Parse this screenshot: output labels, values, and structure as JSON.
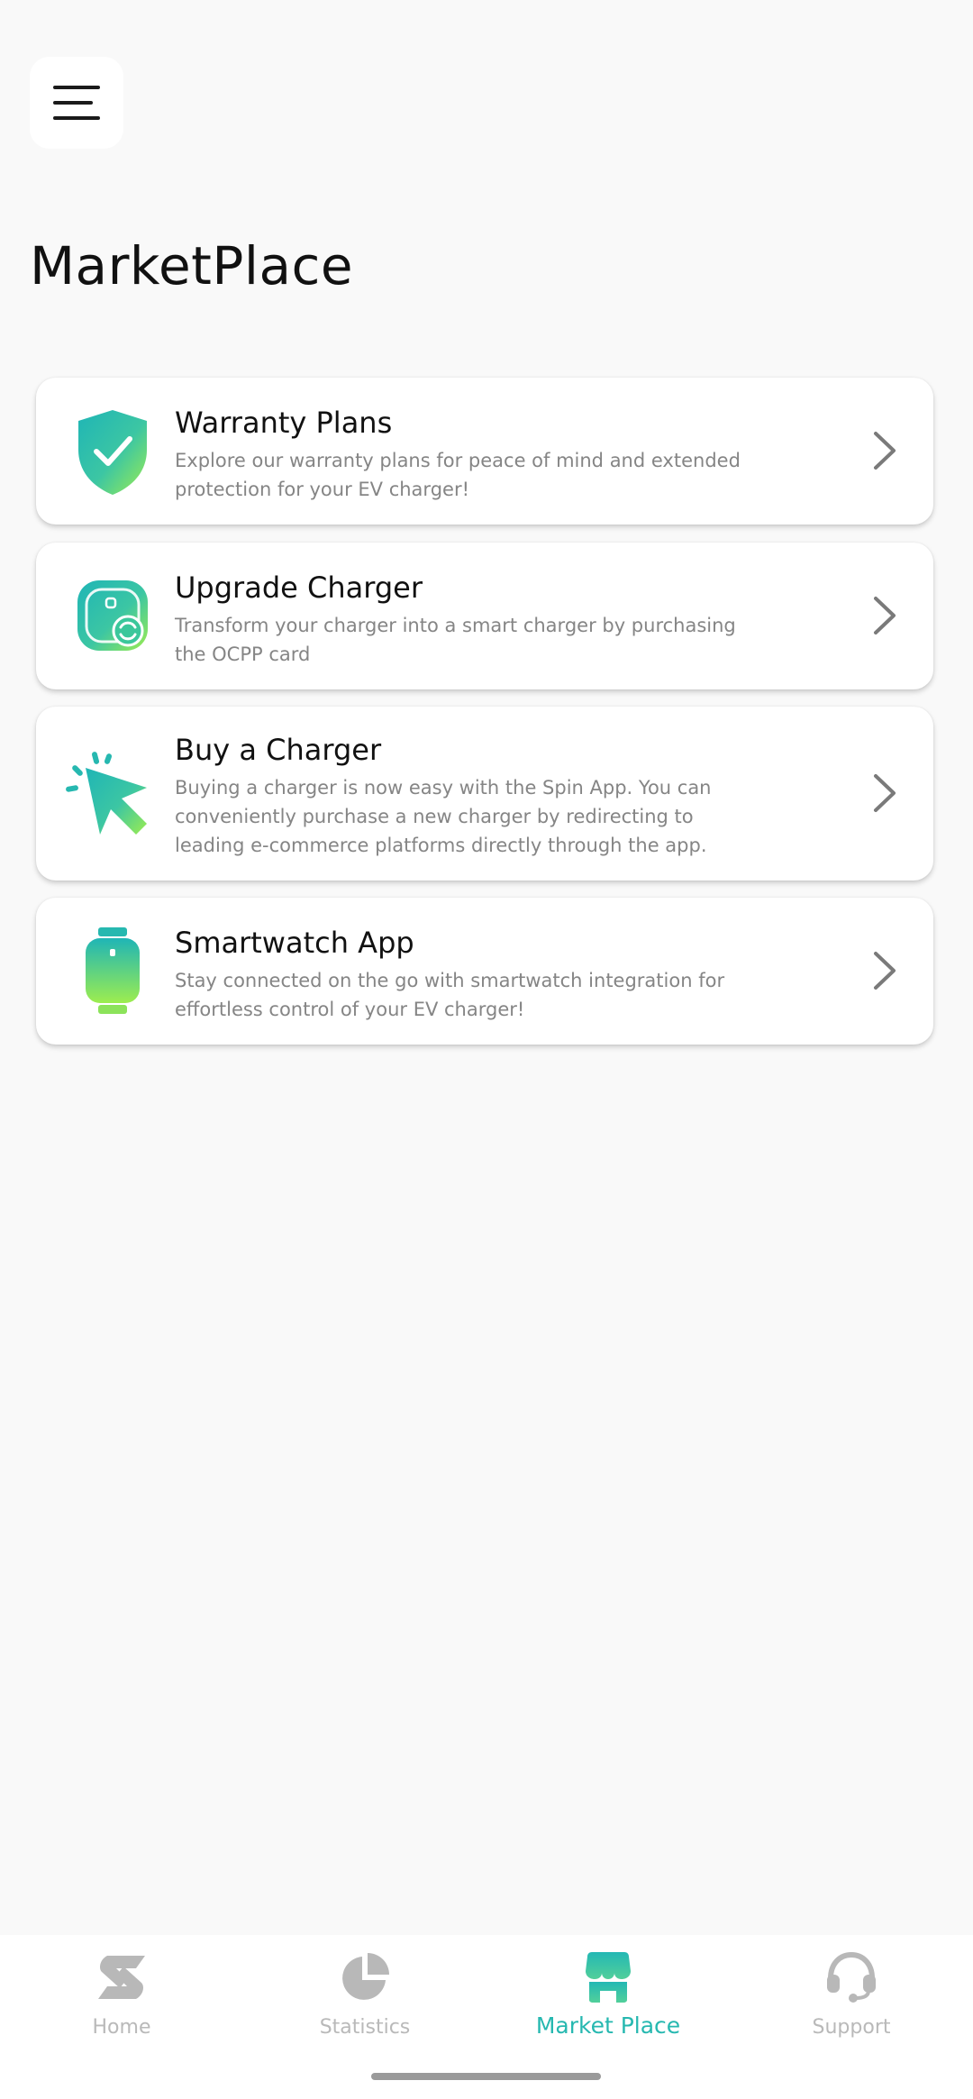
{
  "header": {
    "menu_icon": "hamburger-menu-icon",
    "title": "MarketPlace"
  },
  "cards": [
    {
      "title": "Warranty Plans",
      "description": "Explore our warranty plans for peace of mind and extended protection for your EV charger!",
      "icon": "shield-check-icon"
    },
    {
      "title": "Upgrade Charger",
      "description": "Transform your charger into a smart charger by purchasing the OCPP card",
      "icon": "charger-upgrade-icon"
    },
    {
      "title": "Buy a Charger",
      "description": "Buying a charger is now easy with the Spin App. You can conveniently purchase a new charger by redirecting to leading e-commerce platforms directly through the app.",
      "icon": "cursor-click-icon"
    },
    {
      "title": "Smartwatch App",
      "description": "Stay connected on the go with smartwatch integration for effortless control of your EV charger!",
      "icon": "smartwatch-icon"
    }
  ],
  "bottom_nav": {
    "items": [
      {
        "label": "Home",
        "icon": "spin-logo-icon",
        "active": false
      },
      {
        "label": "Statistics",
        "icon": "pie-chart-icon",
        "active": false
      },
      {
        "label": "Market Place",
        "icon": "store-icon",
        "active": true
      },
      {
        "label": "Support",
        "icon": "headset-icon",
        "active": false
      }
    ]
  },
  "colors": {
    "accent": "#26b8b0",
    "gradient_start": "#1fb5b6",
    "gradient_end": "#8be85a",
    "inactive": "#b9b9b9",
    "background": "#f9f9f9"
  }
}
